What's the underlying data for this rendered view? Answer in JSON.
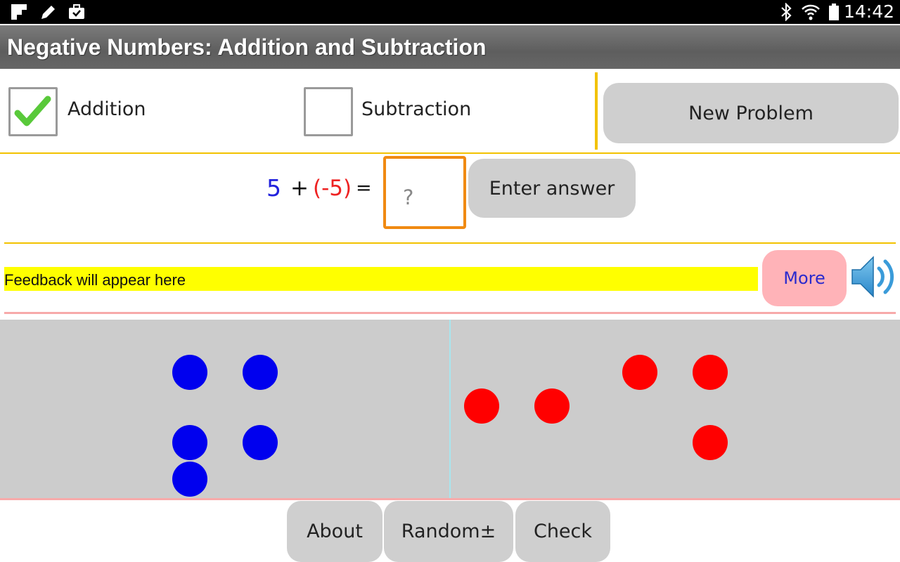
{
  "status_bar": {
    "time": "14:42",
    "left_icons": [
      "flipboard-icon",
      "pencil-icon",
      "briefcase-icon"
    ],
    "right_icons": [
      "bluetooth-icon",
      "wifi-icon",
      "battery-icon"
    ]
  },
  "app": {
    "title": "Negative Numbers: Addition and Subtraction"
  },
  "options": {
    "addition": {
      "label": "Addition",
      "checked": true
    },
    "subtraction": {
      "label": "Subtraction",
      "checked": false
    },
    "new_problem_label": "New Problem"
  },
  "problem": {
    "first": "5",
    "operator": "+",
    "second": "(-5)",
    "equals": "=",
    "answer_placeholder": "?",
    "enter_answer_label": "Enter answer",
    "colors": {
      "first": "#2222dd",
      "second": "#ee2222",
      "operator": "#111111"
    }
  },
  "feedback": {
    "text": "Feedback will appear here",
    "more_label": "More",
    "background": "#ffff00"
  },
  "counters": {
    "positive_count": 5,
    "negative_count": 5,
    "positive_color": "#0000ee",
    "negative_color": "#ff0000"
  },
  "bottom_buttons": {
    "about": "About",
    "random": "Random±",
    "check": "Check"
  }
}
